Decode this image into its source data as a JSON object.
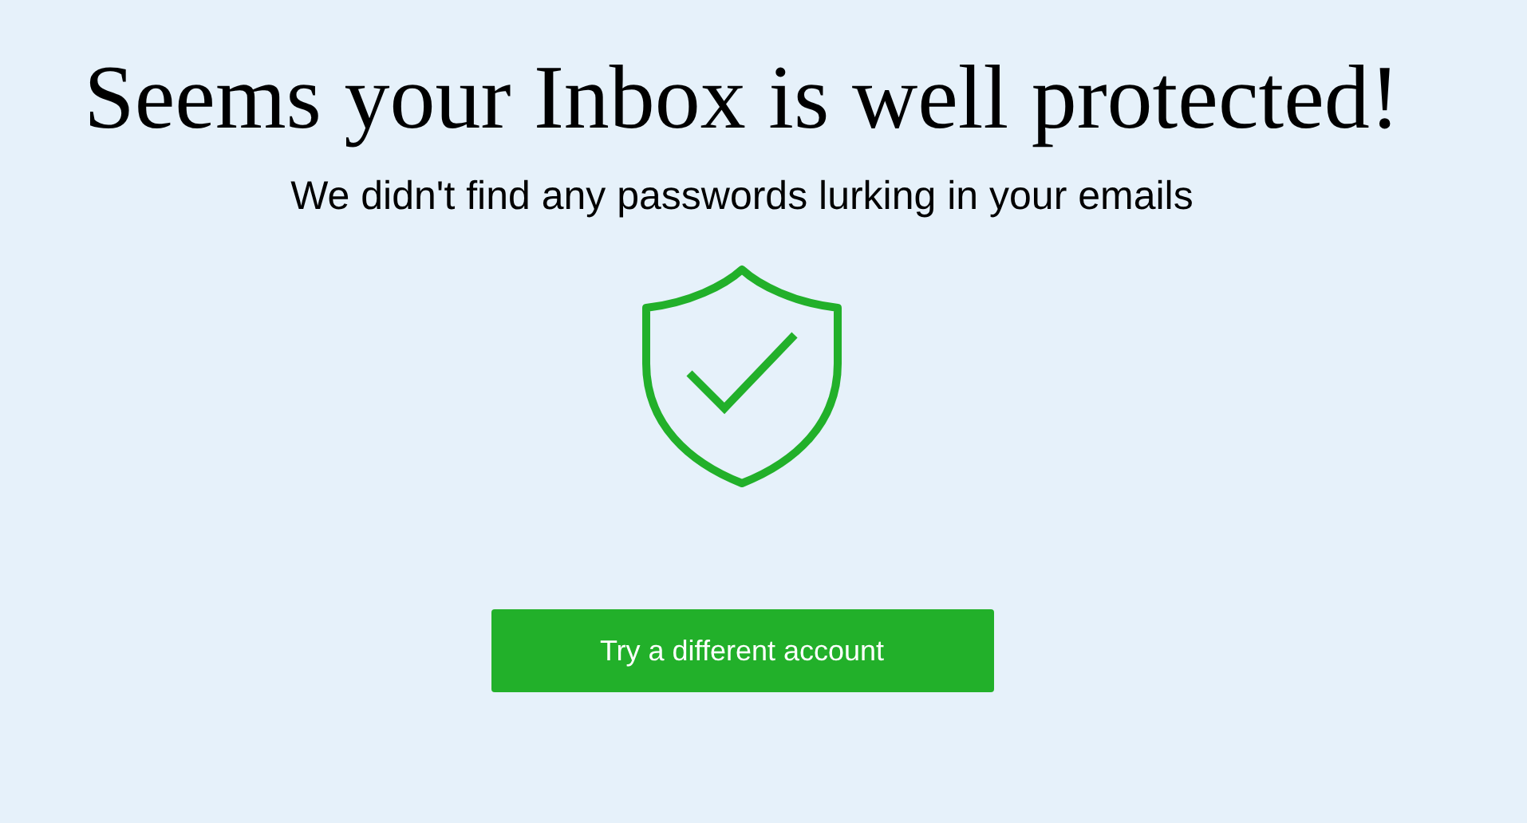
{
  "heading": "Seems your Inbox is well protected!",
  "subheading": "We didn't find any passwords lurking in your emails",
  "button": {
    "label": "Try a different account"
  }
}
